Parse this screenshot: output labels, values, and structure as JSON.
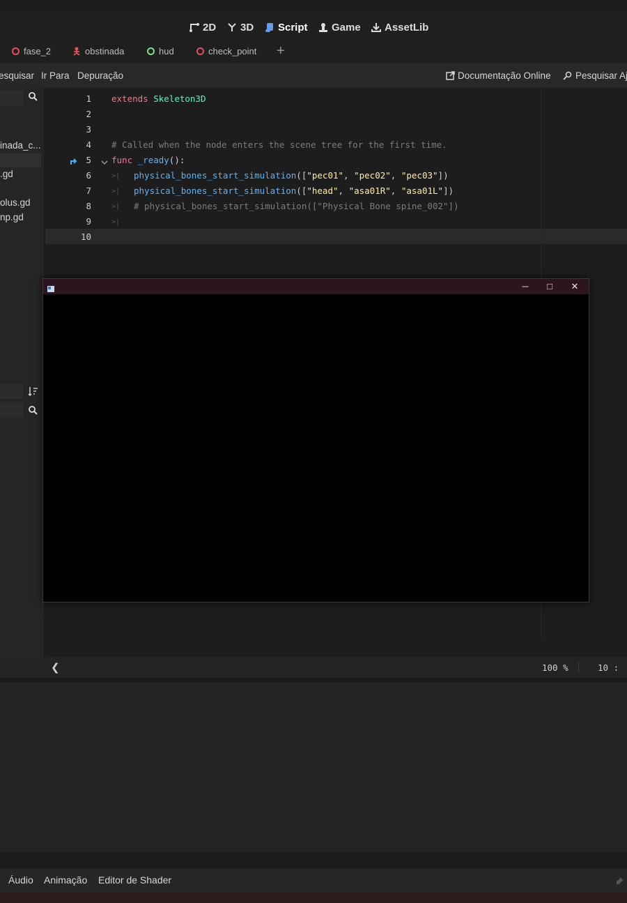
{
  "workspaces": [
    {
      "label": "2D",
      "icon": "2d-icon"
    },
    {
      "label": "3D",
      "icon": "3d-icon"
    },
    {
      "label": "Script",
      "icon": "script-icon",
      "active": true
    },
    {
      "label": "Game",
      "icon": "game-icon"
    },
    {
      "label": "AssetLib",
      "icon": "assetlib-icon"
    }
  ],
  "scene_tabs": [
    {
      "label": "fase_2",
      "icon": "ring-red-icon"
    },
    {
      "label": "obstinada",
      "icon": "skeleton-node-icon"
    },
    {
      "label": "hud",
      "icon": "ring-green-icon"
    },
    {
      "label": "check_point",
      "icon": "ring-red-icon"
    }
  ],
  "menu": {
    "items": [
      "esquisar",
      "Ir Para",
      "Depuração"
    ],
    "right": {
      "docs": "Documentação Online",
      "search_help": "Pesquisar Aj"
    }
  },
  "left_panel": {
    "files": [
      "inada_c...",
      ".gd",
      "olus.gd",
      "np.gd"
    ]
  },
  "editor": {
    "lines": [
      "1",
      "2",
      "3",
      "4",
      "5",
      "6",
      "7",
      "8",
      "9",
      "10"
    ],
    "code": {
      "l1_kw": "extends",
      "l1_type": "Skeleton3D",
      "l4_comment": "# Called when the node enters the scene tree for the first time.",
      "l5_kw": "func",
      "l5_name": "_ready",
      "l6_fn": "physical_bones_start_simulation",
      "l6_args": [
        "\"pec01\"",
        "\"pec02\"",
        "\"pec03\""
      ],
      "l7_fn": "physical_bones_start_simulation",
      "l7_args": [
        "\"head\"",
        "\"asa01R\"",
        "\"asa01L\""
      ],
      "l8_comment": "# physical_bones_start_simulation([\"Physical Bone spine_002\"])"
    }
  },
  "status": {
    "zoom": "100 %",
    "position": "10 :"
  },
  "bottom_tabs": [
    "Áudio",
    "Animação",
    "Editor de Shader"
  ],
  "colors": {
    "keyword": "#ff7085",
    "type": "#42ffc2",
    "function": "#57b3ff",
    "string": "#ffeda1",
    "comment": "#7c7c7c",
    "accent": "#5f9cf5"
  }
}
